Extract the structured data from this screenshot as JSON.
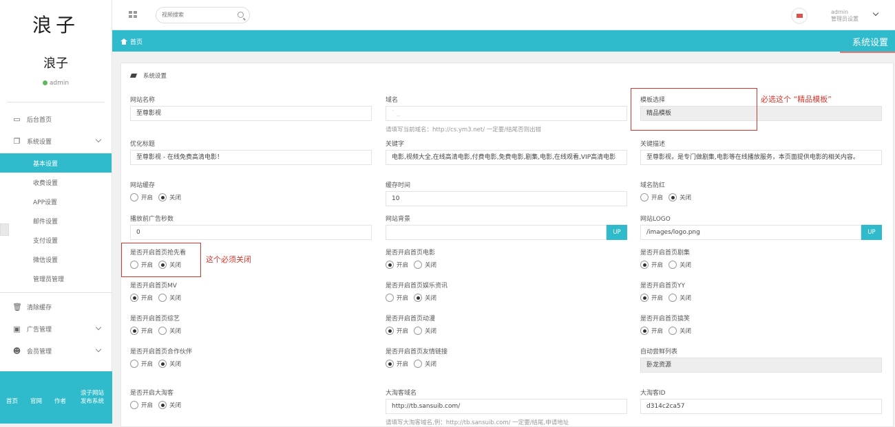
{
  "sidebar": {
    "logo": "浪子",
    "profile_name": "浪子",
    "status": "admin",
    "items": [
      {
        "label": "后台首页",
        "icon": "laptop-icon"
      },
      {
        "label": "系统设置",
        "icon": "copy-icon"
      }
    ],
    "sub_items": [
      "基本设置",
      "收费设置",
      "APP设置",
      "邮件设置",
      "支付设置",
      "微信设置",
      "管理员管理"
    ],
    "bottom_items": [
      {
        "label": "清除缓存",
        "icon": "trash-icon"
      },
      {
        "label": "广告管理",
        "icon": "image-icon"
      },
      {
        "label": "会员管理",
        "icon": "users-icon"
      }
    ],
    "footer_links": [
      "首页",
      "官网",
      "作者",
      "浪子网站发布系统"
    ]
  },
  "topbar": {
    "search_placeholder": "视频搜索",
    "user_name": "admin",
    "user_role": "管理员设置"
  },
  "crumb": {
    "home": "首页",
    "title": "系统设置"
  },
  "panel": {
    "title": "系统设置",
    "fields": {
      "site_name": {
        "label": "网站名称",
        "value": "至尊影视"
      },
      "domain": {
        "label": "域名",
        "value": "` _",
        "hint": "请填写当前域名：http://cs.ym3.net/ 一定要/结尾否则出错"
      },
      "template": {
        "label": "模板选择",
        "value": "精品模板"
      },
      "seo_title": {
        "label": "优化标题",
        "value": "至尊影视 - 在线免费高清电影！"
      },
      "keywords": {
        "label": "关键字",
        "value": "电影,视频大全,在线高清电影,付费电影,免费电影,剧集,电影,在线观看,VIP高清电影"
      },
      "description": {
        "label": "关键描述",
        "value": "至尊影视，是专门做剧集,电影等在线播放服务，本页面提供电影的相关内容。"
      },
      "cache": {
        "label": "网站缓存",
        "on": "开启",
        "off": "关闭"
      },
      "cache_time": {
        "label": "缓存时间",
        "value": "10"
      },
      "anti_red": {
        "label": "域名防红",
        "on": "开启",
        "off": "关闭"
      },
      "ad_seconds": {
        "label": "播放前广告秒数",
        "value": "0"
      },
      "bg": {
        "label": "网站背景",
        "value": "",
        "up": "UP"
      },
      "logo": {
        "label": "网站LOGO",
        "value": "/images/logo.png",
        "up": "UP"
      },
      "preview": {
        "label": "是否开启首页抢先看",
        "on": "开启",
        "off": "关闭"
      },
      "movie": {
        "label": "是否开启首页电影",
        "on": "开启",
        "off": "关闭"
      },
      "series": {
        "label": "是否开启首页剧集",
        "on": "开启",
        "off": "关闭"
      },
      "mv": {
        "label": "是否开启首页MV",
        "on": "开启",
        "off": "关闭"
      },
      "ent_news": {
        "label": "是否开启首页娱乐资讯",
        "on": "开启",
        "off": "关闭"
      },
      "yy": {
        "label": "是否开启首页YY",
        "on": "开启",
        "off": "关闭"
      },
      "variety": {
        "label": "是否开启首页综艺",
        "on": "开启",
        "off": "关闭"
      },
      "anime": {
        "label": "是否开启首页动漫",
        "on": "开启",
        "off": "关闭"
      },
      "funny": {
        "label": "是否开启首页搞笑",
        "on": "开启",
        "off": "关闭"
      },
      "partners": {
        "label": "是否开启首页合作伙伴",
        "on": "开启",
        "off": "关闭"
      },
      "friend_links": {
        "label": "是否开启首页友情链接",
        "on": "开启",
        "off": "关闭"
      },
      "auto_list": {
        "label": "自动尝鲜列表",
        "value": "卧龙资源"
      },
      "taoke": {
        "label": "是否开启大淘客",
        "on": "开启",
        "off": "关闭"
      },
      "taoke_domain": {
        "label": "大淘客域名",
        "value": "http://tb.sansuib.com/",
        "hint": "请填写大淘客域名,例：http://tb.sansuib.com/ 一定要/结尾,申请地址"
      },
      "taoke_id": {
        "label": "大淘客ID",
        "value": "d314c2ca57"
      }
    },
    "annotations": {
      "template_note": "必选这个 “精品模板”",
      "preview_note": "这个必须关闭"
    }
  },
  "colors": {
    "accent": "#2fbbcc",
    "annotation_red": "#d9342b"
  }
}
